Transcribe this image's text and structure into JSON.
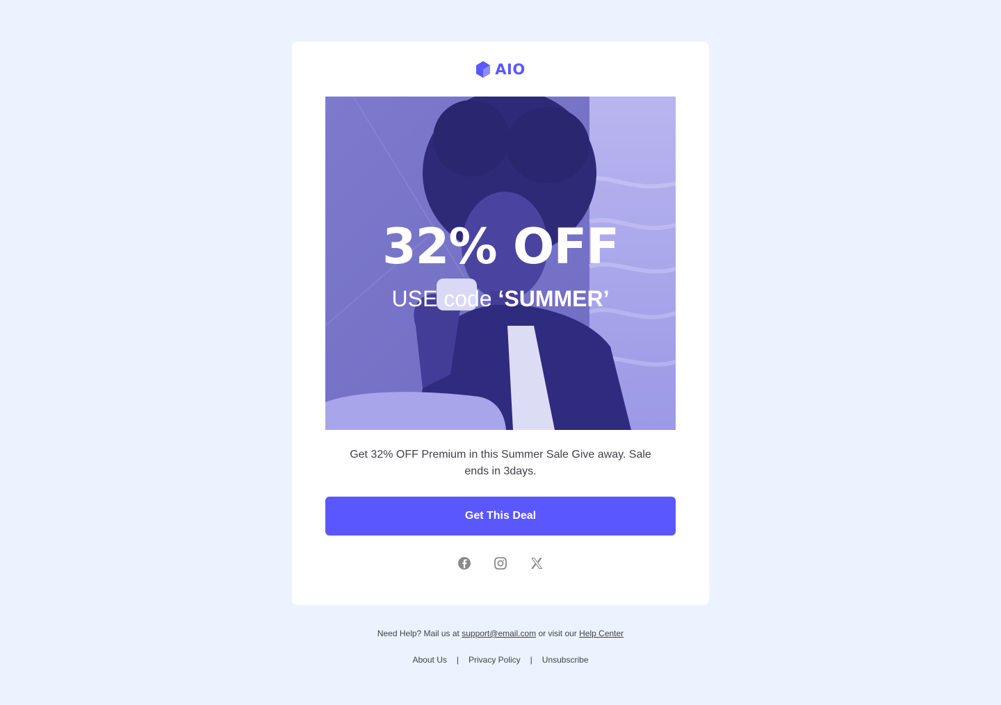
{
  "brand": {
    "name": "AIO",
    "logo_icon": "cube-logo-icon",
    "color": "#5A57FF"
  },
  "hero": {
    "headline": "32% OFF",
    "subline_prefix": "USE code ",
    "code": "‘SUMMER’",
    "overlay_color": "#5A57FF"
  },
  "body": {
    "description": "Get 32% OFF Premium in this Summer Sale Give away. Sale ends in 3days."
  },
  "cta": {
    "label": "Get This Deal",
    "color": "#5A57FF"
  },
  "social": [
    {
      "icon": "facebook-icon"
    },
    {
      "icon": "instagram-icon"
    },
    {
      "icon": "x-twitter-icon"
    }
  ],
  "footer": {
    "help_prefix": "Need Help? Mail us at ",
    "email": "support@email.com",
    "help_middle": " or visit our ",
    "help_center": "Help Center",
    "links": [
      "About Us",
      "Privacy Policy",
      "Unsubscribe"
    ],
    "separator": "|"
  },
  "colors": {
    "page_background": "#ECF3FE",
    "card_background": "#FFFFFF",
    "text": "#3F3F46",
    "icon_gray": "#8A8A8E"
  }
}
